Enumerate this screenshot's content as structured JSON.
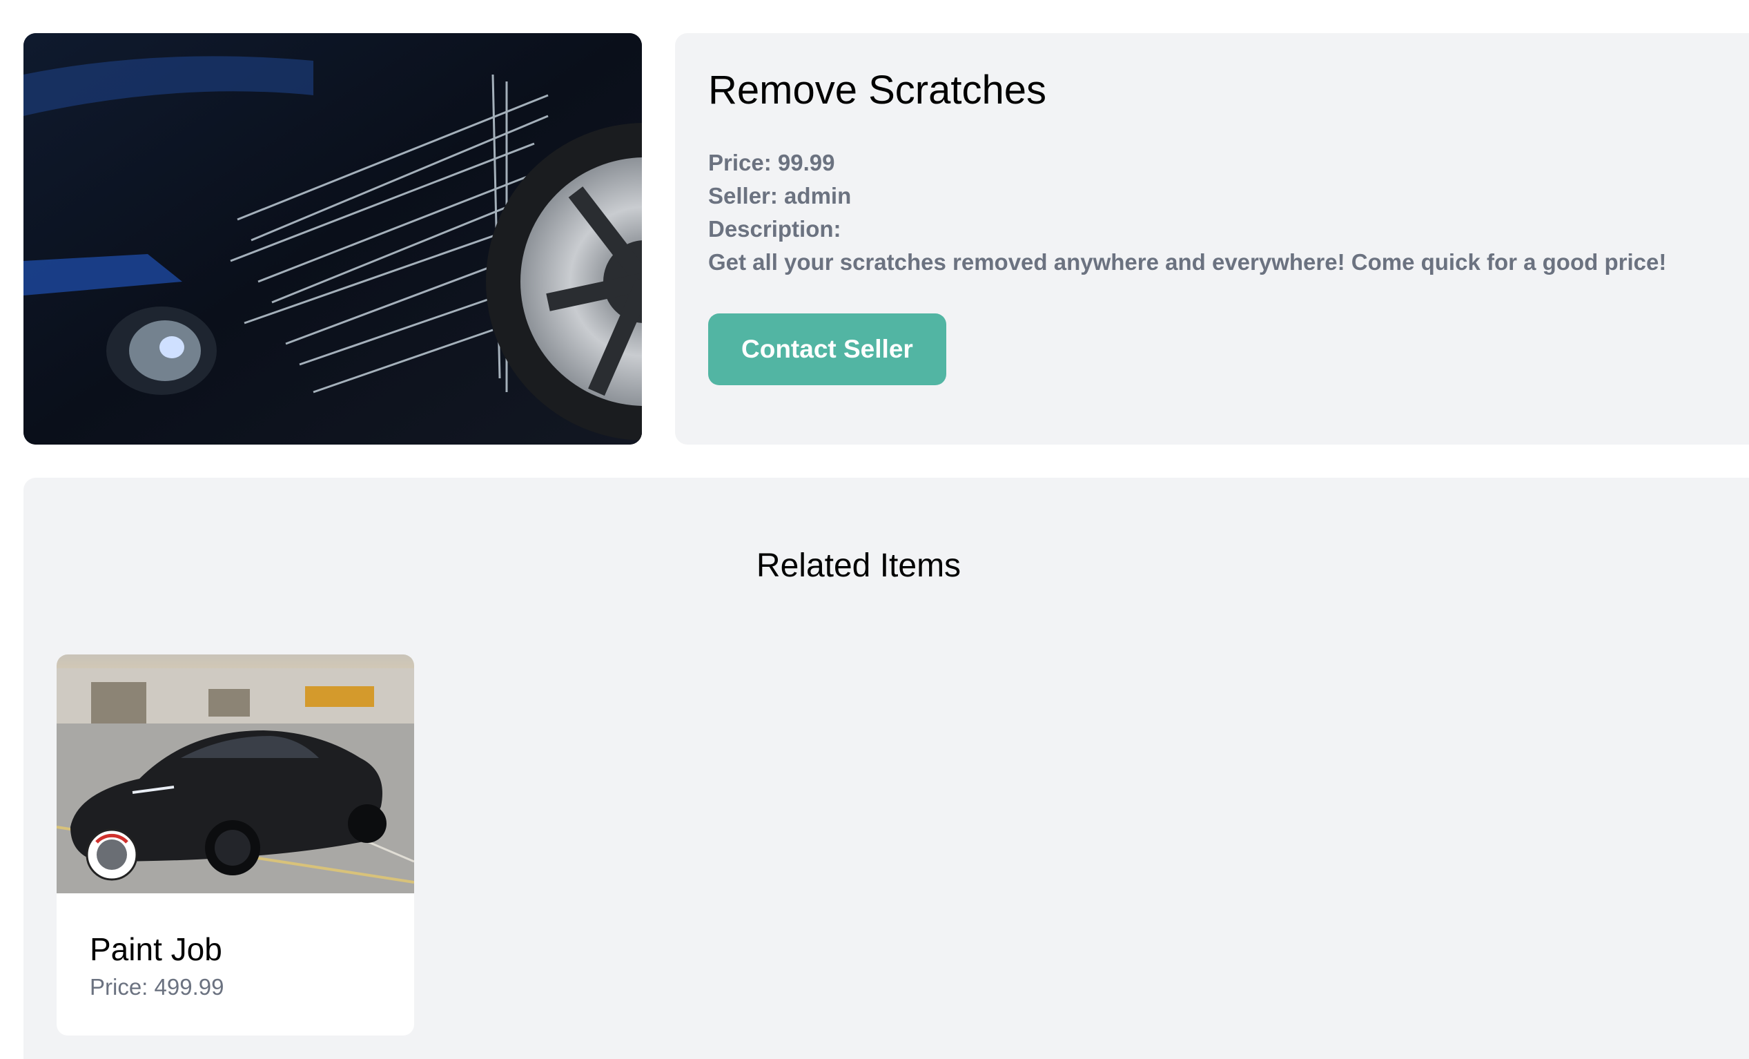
{
  "product": {
    "title": "Remove Scratches",
    "price_line": "Price: 99.99",
    "seller_line": "Seller: admin",
    "description_label": "Description:",
    "description": "Get all your scratches removed anywhere and everywhere! Come quick for a good price!",
    "contact_label": "Contact Seller",
    "image_subject": "scratched dark blue car bumper near front wheel"
  },
  "related": {
    "heading": "Related Items",
    "items": [
      {
        "title": "Paint Job",
        "price_line": "Price: 499.99",
        "image_subject": "matte black sedan in parking lot with logo badge"
      }
    ]
  },
  "colors": {
    "panel_bg": "#f2f3f5",
    "accent": "#52b5a3",
    "muted_text": "#6b7280"
  }
}
